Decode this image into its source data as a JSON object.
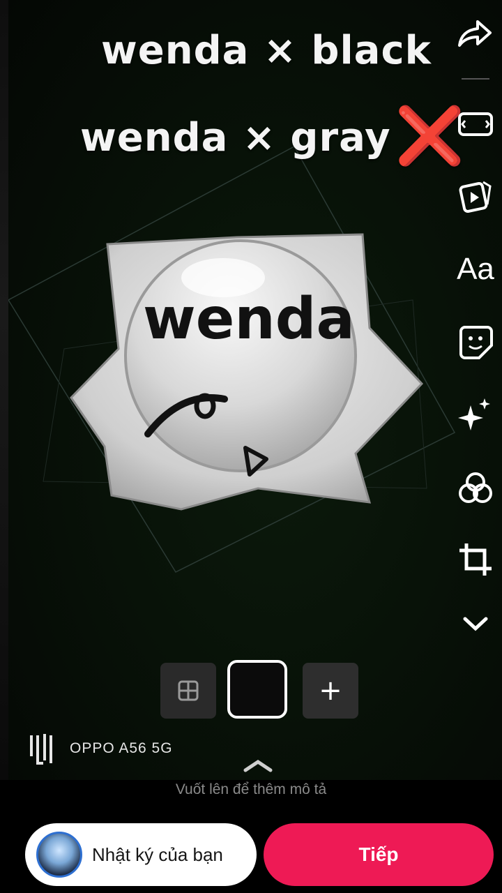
{
  "overlay": {
    "line1": "wenda × black",
    "line2": "wenda × gray",
    "line2_mark": "❌",
    "sticker_text": "wenda"
  },
  "rail": {
    "items": [
      "share-icon",
      "aspect-ratio-icon",
      "video-clip-icon",
      "text-tool",
      "sticker-icon",
      "effects-icon",
      "filters-icon",
      "crop-icon",
      "more-chevron-icon"
    ],
    "text_label": "Aa"
  },
  "picker": {
    "add_label": "+"
  },
  "watermark": {
    "device": "OPPO A56 5G"
  },
  "footer": {
    "hint": "Vuốt lên để thêm mô tả",
    "diary_label": "Nhật ký của bạn",
    "next_label": "Tiếp"
  },
  "colors": {
    "accent": "#ee1a55",
    "x_mark": "#e23b4e"
  }
}
